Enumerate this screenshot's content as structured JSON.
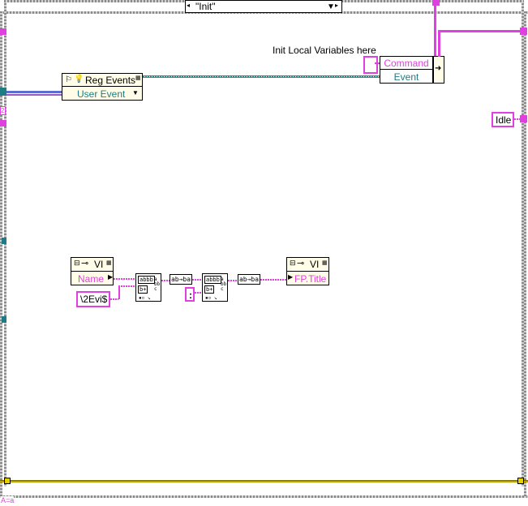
{
  "case_selector": {
    "value": "\"Init\""
  },
  "comment": "Init Local Variables here",
  "reg_events": {
    "title": "Reg Events",
    "terminal": "User Event"
  },
  "bundle_node": {
    "command_label": "Command",
    "event_label": "Event"
  },
  "idle_constant": "Idle",
  "vi_server_1": {
    "title": "VI",
    "terminal": "Name"
  },
  "vi_server_2": {
    "title": "VI",
    "terminal": "FP.Title"
  },
  "string_constant_evi": "\\2Evi$",
  "string_constant_colon": ":",
  "concat_icon_text": {
    "line1": "abbb",
    "line2": "b+",
    "line3": "a\nbb\nc"
  },
  "convert_label": "ab→ba",
  "bottom_label": "A=a",
  "colors": {
    "string_wire": "#e040e0",
    "refnum_wire": "#2f8f8f",
    "error_wire": "#b8a400",
    "frame": "#8a8a8a"
  }
}
